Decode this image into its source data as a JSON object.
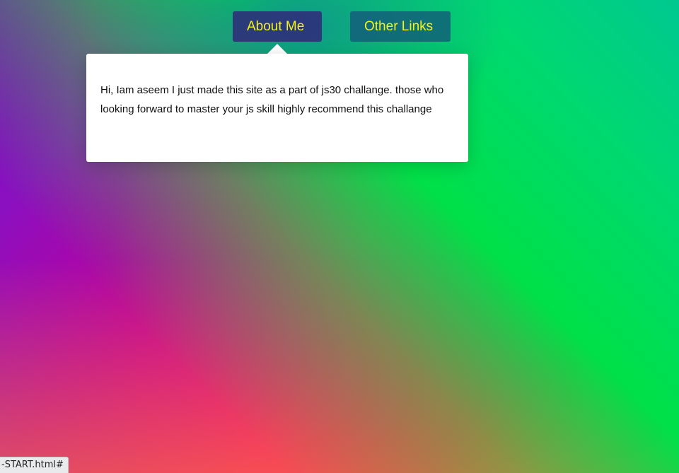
{
  "nav": {
    "about_label": "About Me",
    "links_label": "Other Links"
  },
  "dropdown": {
    "text": "Hi, Iam aseem I just made this site as a part of js30 challange. those who looking forward to master your js skill highly recommend this challange"
  },
  "status_bar": {
    "url": "-START.html#"
  },
  "colors": {
    "nav_text": "#f2f21a",
    "dropdown_bg": "#ffffff"
  }
}
